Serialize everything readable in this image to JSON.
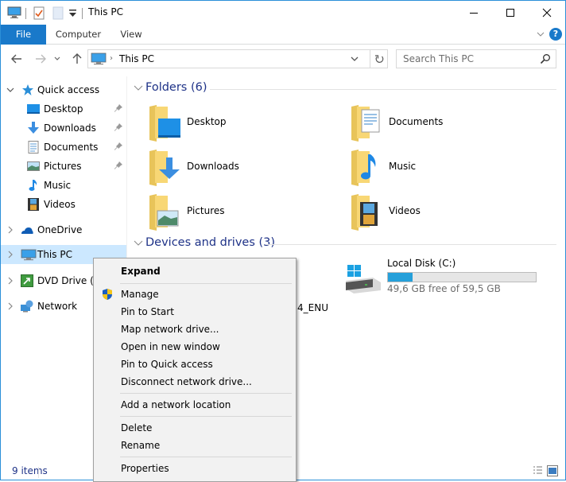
{
  "window": {
    "title": "This PC",
    "controls": {
      "minimize": "minimize",
      "maximize": "maximize",
      "close": "close"
    }
  },
  "ribbon": {
    "tabs": [
      {
        "label": "File",
        "active": true
      },
      {
        "label": "Computer"
      },
      {
        "label": "View"
      }
    ],
    "help": "?"
  },
  "navbar": {
    "address": {
      "separator": "›",
      "path": "This PC"
    },
    "search": {
      "placeholder": "Search This PC"
    }
  },
  "navpane": {
    "quick_access": {
      "label": "Quick access",
      "items": [
        {
          "label": "Desktop",
          "pinned": true
        },
        {
          "label": "Downloads",
          "pinned": true
        },
        {
          "label": "Documents",
          "pinned": true
        },
        {
          "label": "Pictures",
          "pinned": true
        },
        {
          "label": "Music",
          "pinned": false
        },
        {
          "label": "Videos",
          "pinned": false
        }
      ]
    },
    "roots": [
      {
        "label": "OneDrive"
      },
      {
        "label": "This PC",
        "selected": true
      },
      {
        "label": "DVD Drive (D:"
      },
      {
        "label": "Network"
      }
    ]
  },
  "content": {
    "folders_header": "Folders (6)",
    "folders": [
      {
        "label": "Desktop"
      },
      {
        "label": "Documents"
      },
      {
        "label": "Downloads"
      },
      {
        "label": "Music"
      },
      {
        "label": "Pictures"
      },
      {
        "label": "Videos"
      }
    ],
    "devices_header": "Devices and drives (3)",
    "drives": [
      {
        "label": "Local Disk (C:)",
        "free_text": "49,6 GB free of 59,5 GB",
        "used_fraction": 0.167
      }
    ],
    "dvd_label_fragment": "4_ENU"
  },
  "status": {
    "items_count": "9 items"
  },
  "context_menu": {
    "items": [
      {
        "label": "Expand",
        "bold": true
      },
      {
        "separator": true
      },
      {
        "label": "Manage",
        "icon": "uac-shield-icon"
      },
      {
        "label": "Pin to Start"
      },
      {
        "label": "Map network drive..."
      },
      {
        "label": "Open in new window"
      },
      {
        "label": "Pin to Quick access"
      },
      {
        "label": "Disconnect network drive..."
      },
      {
        "separator": true
      },
      {
        "label": "Add a network location"
      },
      {
        "separator": true
      },
      {
        "label": "Delete"
      },
      {
        "label": "Rename"
      },
      {
        "separator": true
      },
      {
        "label": "Properties"
      }
    ]
  },
  "colors": {
    "accent": "#1979ca",
    "selection": "#cce8ff",
    "group_header": "#1e3287",
    "drive_fill": "#26a0da"
  }
}
